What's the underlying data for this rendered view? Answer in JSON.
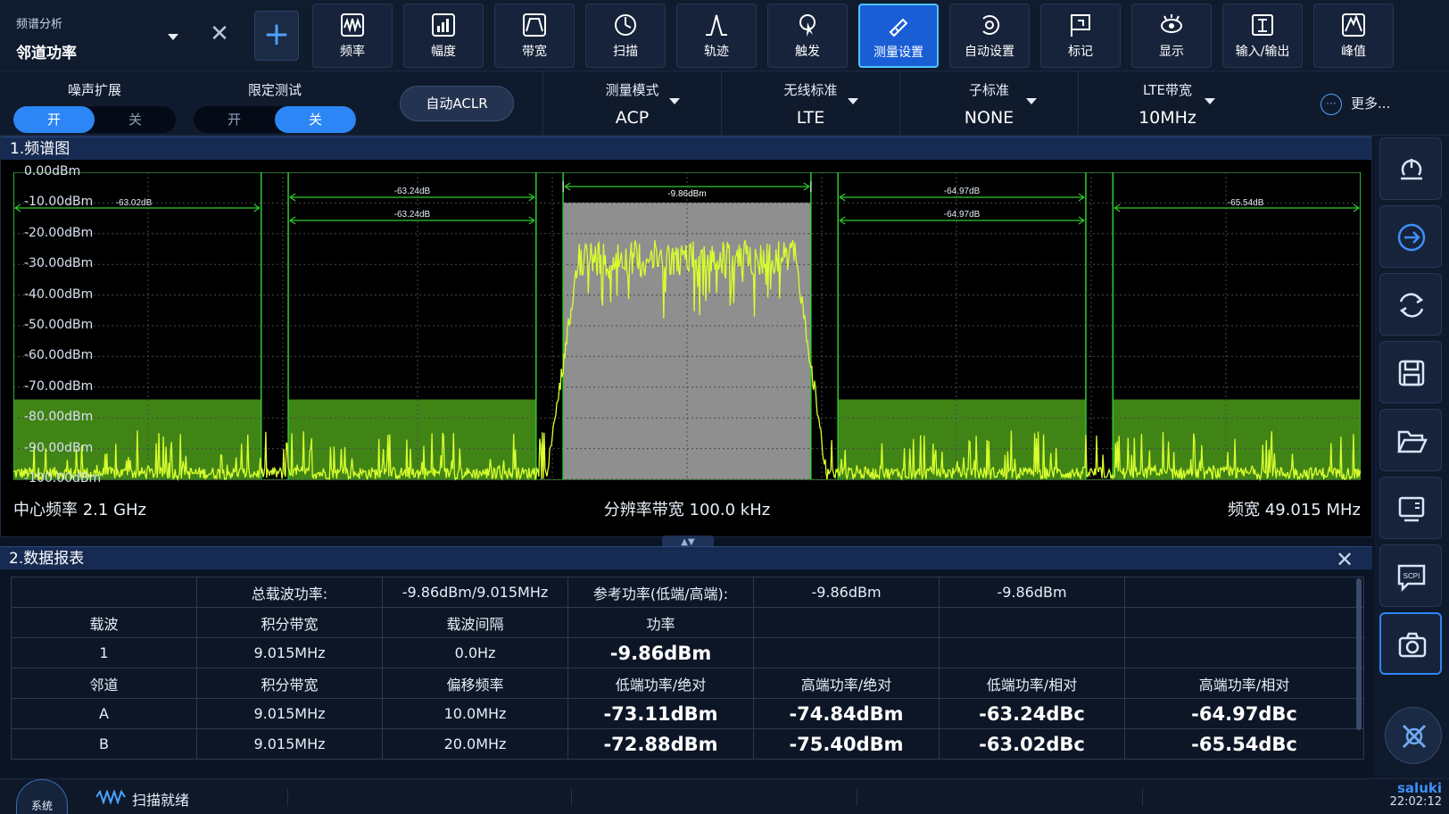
{
  "app": {
    "mode_label": "频谱分析",
    "measurement": "邻道功率"
  },
  "toolbar": [
    {
      "label": "频率",
      "icon": "frequency-icon"
    },
    {
      "label": "幅度",
      "icon": "amplitude-icon"
    },
    {
      "label": "带宽",
      "icon": "bandwidth-icon"
    },
    {
      "label": "扫描",
      "icon": "sweep-icon"
    },
    {
      "label": "轨迹",
      "icon": "trace-icon"
    },
    {
      "label": "触发",
      "icon": "trigger-icon"
    },
    {
      "label": "测量设置",
      "icon": "meas-setup-icon",
      "active": true
    },
    {
      "label": "自动设置",
      "icon": "auto-setup-icon"
    },
    {
      "label": "标记",
      "icon": "marker-icon"
    },
    {
      "label": "显示",
      "icon": "display-icon"
    },
    {
      "label": "输入/输出",
      "icon": "io-icon"
    },
    {
      "label": "峰值",
      "icon": "peak-icon"
    }
  ],
  "settings": {
    "noise_ext": {
      "title": "噪声扩展",
      "on": "开",
      "off": "关",
      "selected": "on"
    },
    "limit_test": {
      "title": "限定测试",
      "on": "开",
      "off": "关",
      "selected": "off"
    },
    "auto_aclr": "自动ACLR",
    "meas_mode": {
      "title": "测量模式",
      "value": "ACP"
    },
    "wireless_std": {
      "title": "无线标准",
      "value": "LTE"
    },
    "sub_std": {
      "title": "子标准",
      "value": "NONE"
    },
    "lte_bw": {
      "title": "LTE带宽",
      "value": "10MHz"
    },
    "more": "更多..."
  },
  "spectrum": {
    "header": "1.频谱图",
    "center_freq": "中心频率 2.1 GHz",
    "rbw": "分辨率带宽 100.0 kHz",
    "span": "频宽 49.015 MHz"
  },
  "chart_data": {
    "type": "line",
    "y_ticks": [
      "0.00dBm",
      "-10.00dBm",
      "-20.00dBm",
      "-30.00dBm",
      "-40.00dBm",
      "-50.00dBm",
      "-60.00dBm",
      "-70.00dBm",
      "-80.00dBm",
      "-90.00dBm",
      "-100.00dBm"
    ],
    "ylim": [
      -100,
      0
    ],
    "xlim_mhz": [
      -24.5075,
      24.5075
    ],
    "grid": true,
    "channels": [
      {
        "name": "B-low",
        "start_mhz": -24.5075,
        "end_mhz": -15.4925,
        "level_dbm": -72.88,
        "label": "-63.02dB"
      },
      {
        "name": "A-low",
        "start_mhz": -14.5075,
        "end_mhz": -5.4925,
        "level_dbm": -73.11,
        "label": "-63.24dB"
      },
      {
        "name": "carrier",
        "start_mhz": -4.5075,
        "end_mhz": 4.5075,
        "level_dbm": -9.86,
        "label": "-9.86dBm"
      },
      {
        "name": "A-high",
        "start_mhz": 5.4925,
        "end_mhz": 14.5075,
        "level_dbm": -74.84,
        "label": "-64.97dB"
      },
      {
        "name": "B-high",
        "start_mhz": 15.4925,
        "end_mhz": 24.5075,
        "level_dbm": -75.4,
        "label": "-65.54dB"
      }
    ],
    "trace": {
      "noise_floor_dbm": -97,
      "noise_peak_dbm": -87,
      "carrier_top_dbm": -22,
      "carrier_bottom_dbm": -48
    }
  },
  "report": {
    "header": "2.数据报表",
    "rows": [
      [
        "",
        "总载波功率:",
        "-9.86dBm/9.015MHz",
        "参考功率(低端/高端):",
        "-9.86dBm",
        "-9.86dBm",
        ""
      ],
      [
        "载波",
        "积分带宽",
        "载波间隔",
        "功率",
        "",
        "",
        ""
      ],
      [
        "1",
        "9.015MHz",
        "0.0Hz",
        "-9.86dBm",
        "",
        "",
        ""
      ],
      [
        "邻道",
        "积分带宽",
        "偏移频率",
        "低端功率/绝对",
        "高端功率/绝对",
        "低端功率/相对",
        "高端功率/相对"
      ],
      [
        "A",
        "9.015MHz",
        "10.0MHz",
        "-73.11dBm",
        "-74.84dBm",
        "-63.24dBc",
        "-64.97dBc"
      ],
      [
        "B",
        "9.015MHz",
        "20.0MHz",
        "-72.88dBm",
        "-75.40dBm",
        "-63.02dBc",
        "-65.54dBc"
      ]
    ]
  },
  "sidebar": [
    {
      "name": "preset-icon"
    },
    {
      "name": "local-icon"
    },
    {
      "name": "refresh-icon"
    },
    {
      "name": "save-icon"
    },
    {
      "name": "open-folder-icon"
    },
    {
      "name": "screen-icon"
    },
    {
      "name": "scpi-icon",
      "text": "SCPI"
    },
    {
      "name": "screenshot-icon"
    }
  ],
  "status": {
    "system_label": "系统",
    "scan_status": "扫描就绪",
    "brand": "saluki",
    "time": "22:02:12"
  },
  "colors": {
    "trace": "#d9ff2e",
    "channel_fill": "#4c9b1a",
    "carrier_fill": "#8f8f8f",
    "marker_line": "#2ecc2e",
    "accent": "#2c86f5"
  }
}
